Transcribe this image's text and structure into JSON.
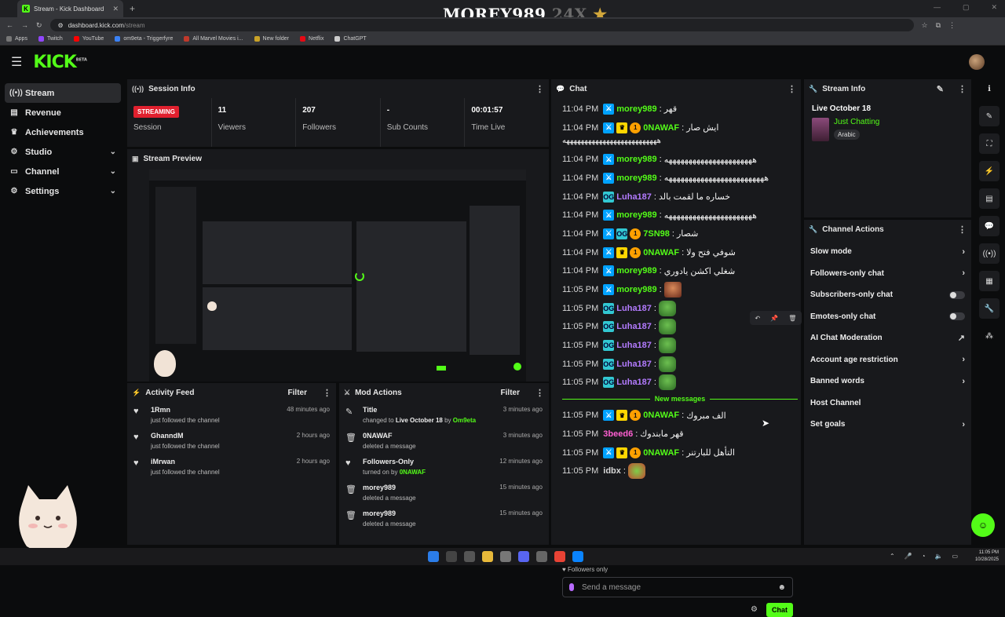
{
  "browser": {
    "tab_title": "Stream - Kick Dashboard",
    "url_host": "dashboard.kick.com",
    "url_path": "/stream",
    "bookmarks": [
      "Apps",
      "Twitch",
      "YouTube",
      "om9eta - Triggerfyre",
      "All Marvel Movies i...",
      "New folder",
      "Netflix",
      "ChatGPT"
    ]
  },
  "overlay": {
    "name": "MOREY989",
    "multiplier": "24X",
    "star": "★"
  },
  "header": {
    "logo": "KICK",
    "logo_tag": "BETA"
  },
  "sidebar": {
    "items": [
      {
        "label": "Stream",
        "icon": "((•))",
        "chev": ""
      },
      {
        "label": "Revenue",
        "icon": "▤",
        "chev": ""
      },
      {
        "label": "Achievements",
        "icon": "♛",
        "chev": ""
      },
      {
        "label": "Studio",
        "icon": "⚙",
        "chev": "⌄"
      },
      {
        "label": "Channel",
        "icon": "▭",
        "chev": "⌄"
      },
      {
        "label": "Settings",
        "icon": "⚙",
        "chev": "⌄"
      }
    ]
  },
  "session": {
    "title": "Session Info",
    "badge": "STREAMING",
    "cells": [
      {
        "value": "",
        "label": "Session"
      },
      {
        "value": "11",
        "label": "Viewers"
      },
      {
        "value": "207",
        "label": "Followers"
      },
      {
        "value": "-",
        "label": "Sub Counts"
      },
      {
        "value": "00:01:57",
        "label": "Time Live"
      }
    ]
  },
  "preview": {
    "title": "Stream Preview"
  },
  "activity": {
    "title": "Activity Feed",
    "filter": "Filter",
    "rows": [
      {
        "name": "1Rmn",
        "sub": "just followed the channel",
        "time": "48 minutes ago"
      },
      {
        "name": "GhanndM",
        "sub": "just followed the channel",
        "time": "2 hours ago"
      },
      {
        "name": "iMrwan",
        "sub": "just followed the channel",
        "time": "2 hours ago"
      }
    ]
  },
  "mod": {
    "title": "Mod Actions",
    "filter": "Filter",
    "rows": [
      {
        "icon": "✎",
        "name": "Title",
        "sub_a": "changed to ",
        "sub_b": "Live October 18",
        "sub_c": " by ",
        "sub_d": "Om9eta",
        "time": "3 minutes ago"
      },
      {
        "icon": "🗑",
        "name": "0NAWAF",
        "sub_a": "deleted a message",
        "sub_b": "",
        "sub_c": "",
        "sub_d": "",
        "time": "3 minutes ago"
      },
      {
        "icon": "♥",
        "name": "Followers-Only",
        "sub_a": "turned on by ",
        "sub_b": "",
        "sub_c": "",
        "sub_d": "0NAWAF",
        "time": "12 minutes ago"
      },
      {
        "icon": "🗑",
        "name": "morey989",
        "sub_a": "deleted a message",
        "sub_b": "",
        "sub_c": "",
        "sub_d": "",
        "time": "15 minutes ago"
      },
      {
        "icon": "🗑",
        "name": "morey989",
        "sub_a": "deleted a message",
        "sub_b": "",
        "sub_c": "",
        "sub_d": "",
        "time": "15 minutes ago"
      }
    ]
  },
  "chat": {
    "title": "Chat",
    "new_messages": "New messages",
    "followers_only": "♥ Followers only",
    "placeholder": "Send a message",
    "send": "Chat",
    "messages": [
      {
        "time": "11:04 PM",
        "user": "morey989",
        "color": "#53fc18",
        "badges": [
          "mod"
        ],
        "text": "قهر"
      },
      {
        "time": "11:04 PM",
        "user": "0NAWAF",
        "color": "#53fc18",
        "badges": [
          "mod",
          "vip",
          "sub"
        ],
        "text": "ايش صار",
        "wrap": "ههههههههههههههههههههههههههه"
      },
      {
        "time": "11:04 PM",
        "user": "morey989",
        "color": "#53fc18",
        "badges": [
          "mod"
        ],
        "text": "ههههههههههههههههههههههه"
      },
      {
        "time": "11:04 PM",
        "user": "morey989",
        "color": "#53fc18",
        "badges": [
          "mod"
        ],
        "text": "هههههههههههههههههههههههههه"
      },
      {
        "time": "11:04 PM",
        "user": "Luha187",
        "color": "#b37bff",
        "badges": [
          "og"
        ],
        "text": "خساره ما لقمت بالد"
      },
      {
        "time": "11:04 PM",
        "user": "morey989",
        "color": "#53fc18",
        "badges": [
          "mod"
        ],
        "text": "ههههههههههههههههههههههه"
      },
      {
        "time": "11:04 PM",
        "user": "7SN98",
        "color": "#53fc18",
        "badges": [
          "mod",
          "og",
          "sub"
        ],
        "text": "شصار"
      },
      {
        "time": "11:04 PM",
        "user": "0NAWAF",
        "color": "#53fc18",
        "badges": [
          "mod",
          "vip",
          "sub"
        ],
        "text": "شوفي فتح ولا"
      },
      {
        "time": "11:04 PM",
        "user": "morey989",
        "color": "#53fc18",
        "badges": [
          "mod"
        ],
        "text": "شغلي اكشن يادوري"
      },
      {
        "time": "11:05 PM",
        "user": "morey989",
        "color": "#53fc18",
        "badges": [
          "mod"
        ],
        "text": "",
        "emote": "face"
      },
      {
        "time": "11:05 PM",
        "user": "Luha187",
        "color": "#b37bff",
        "badges": [
          "og"
        ],
        "text": "",
        "emote": "pepe"
      },
      {
        "time": "11:05 PM",
        "user": "Luha187",
        "color": "#b37bff",
        "badges": [
          "og"
        ],
        "text": "",
        "emote": "pepe"
      },
      {
        "time": "11:05 PM",
        "user": "Luha187",
        "color": "#b37bff",
        "badges": [
          "og"
        ],
        "text": "",
        "emote": "pepe"
      },
      {
        "time": "11:05 PM",
        "user": "Luha187",
        "color": "#b37bff",
        "badges": [
          "og"
        ],
        "text": "",
        "emote": "pepe"
      },
      {
        "time": "11:05 PM",
        "user": "Luha187",
        "color": "#b37bff",
        "badges": [
          "og"
        ],
        "text": "",
        "emote": "pepe"
      }
    ],
    "new_list": [
      {
        "time": "11:05 PM",
        "user": "0NAWAF",
        "color": "#53fc18",
        "badges": [
          "mod",
          "vip",
          "sub"
        ],
        "text": "الف مبروك"
      },
      {
        "time": "11:05 PM",
        "user": "3beed6",
        "color": "#ff5fd2",
        "badges": [],
        "text": "قهر مابندوك"
      },
      {
        "time": "11:05 PM",
        "user": "0NAWAF",
        "color": "#53fc18",
        "badges": [
          "mod",
          "vip",
          "sub"
        ],
        "text": "التأهل للبارتنر"
      },
      {
        "time": "11:05 PM",
        "user": "idbx",
        "color": "#d6d6d6",
        "badges": [],
        "text": "",
        "emote": "gift"
      }
    ]
  },
  "stream_info": {
    "title": "Stream Info",
    "date": "Live October 18",
    "game": "Just Chatting",
    "tag": "Arabic"
  },
  "channel_actions": {
    "title": "Channel Actions",
    "items": [
      {
        "label": "Slow mode",
        "kind": "chev"
      },
      {
        "label": "Followers-only chat",
        "kind": "chev"
      },
      {
        "label": "Subscribers-only chat",
        "kind": "toggle"
      },
      {
        "label": "Emotes-only chat",
        "kind": "toggle"
      },
      {
        "label": "AI Chat Moderation",
        "kind": "ext"
      },
      {
        "label": "Account age restriction",
        "kind": "chev"
      },
      {
        "label": "Banned words",
        "kind": "chev"
      },
      {
        "label": "Host Channel",
        "kind": "none"
      },
      {
        "label": "Set goals",
        "kind": "chev"
      }
    ]
  },
  "taskbar": {
    "time": "11:05 PM",
    "date": "10/28/2025"
  },
  "colors": {
    "accent": "#53fc18",
    "panel": "#18191c",
    "live": "#e0202e"
  }
}
